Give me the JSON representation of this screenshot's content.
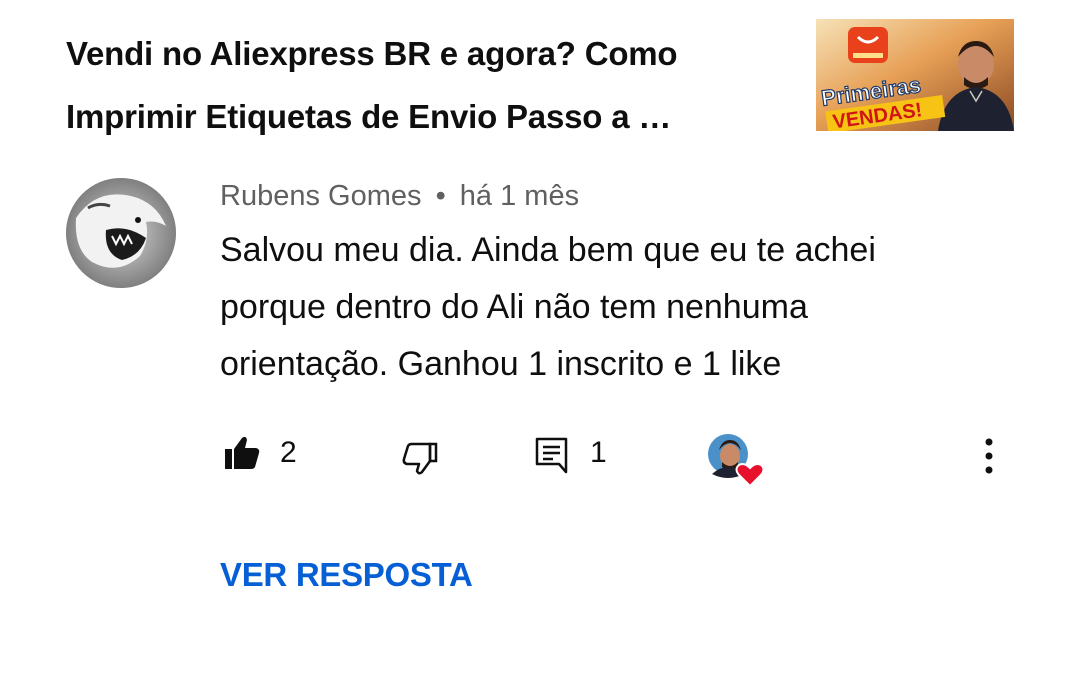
{
  "video": {
    "title_line1": "Vendi no Aliexpress BR e agora? Como",
    "title_line2": "Imprimir Etiquetas de Envio Passo a …",
    "thumbnail": {
      "text_line1": "Primeiras",
      "text_line2": "VENDAS!",
      "icon": "aliexpress-logo-icon"
    }
  },
  "comment": {
    "author": "Rubens Gomes",
    "separator": "•",
    "time": "há 1 mês",
    "text_line1": "Salvou meu dia. Ainda bem que eu te achei",
    "text_line2": "porque dentro do Ali não tem nenhuma",
    "text_line3": "orientação. Ganhou 1 inscrito e 1 like",
    "avatar_icon": "wolf-avatar-icon"
  },
  "actions": {
    "like_icon": "thumbs-up-filled-icon",
    "like_count": "2",
    "dislike_icon": "thumbs-down-icon",
    "reply_icon": "comment-reply-icon",
    "reply_count": "1",
    "creator_heart_icon": "creator-heart-icon",
    "more_icon": "more-vert-icon"
  },
  "replies": {
    "label": "VER RESPOSTA"
  },
  "colors": {
    "link": "#065fd4",
    "secondary_text": "#606060",
    "primary_text": "#0f0f0f",
    "heart": "#e8112d"
  }
}
